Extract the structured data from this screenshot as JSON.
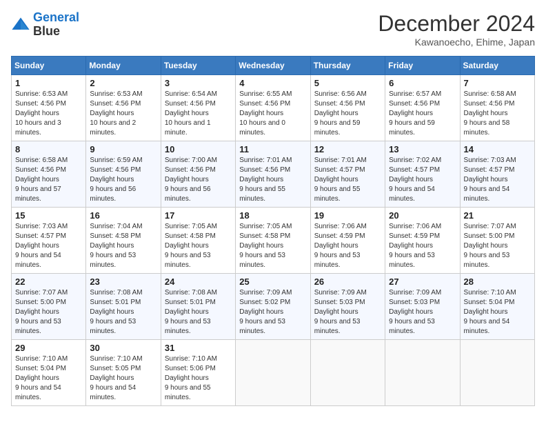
{
  "header": {
    "logo_line1": "General",
    "logo_line2": "Blue",
    "month_title": "December 2024",
    "location": "Kawanoecho, Ehime, Japan"
  },
  "weekdays": [
    "Sunday",
    "Monday",
    "Tuesday",
    "Wednesday",
    "Thursday",
    "Friday",
    "Saturday"
  ],
  "weeks": [
    [
      {
        "day": "1",
        "sunrise": "6:53 AM",
        "sunset": "4:56 PM",
        "daylight": "10 hours and 3 minutes."
      },
      {
        "day": "2",
        "sunrise": "6:53 AM",
        "sunset": "4:56 PM",
        "daylight": "10 hours and 2 minutes."
      },
      {
        "day": "3",
        "sunrise": "6:54 AM",
        "sunset": "4:56 PM",
        "daylight": "10 hours and 1 minute."
      },
      {
        "day": "4",
        "sunrise": "6:55 AM",
        "sunset": "4:56 PM",
        "daylight": "10 hours and 0 minutes."
      },
      {
        "day": "5",
        "sunrise": "6:56 AM",
        "sunset": "4:56 PM",
        "daylight": "9 hours and 59 minutes."
      },
      {
        "day": "6",
        "sunrise": "6:57 AM",
        "sunset": "4:56 PM",
        "daylight": "9 hours and 59 minutes."
      },
      {
        "day": "7",
        "sunrise": "6:58 AM",
        "sunset": "4:56 PM",
        "daylight": "9 hours and 58 minutes."
      }
    ],
    [
      {
        "day": "8",
        "sunrise": "6:58 AM",
        "sunset": "4:56 PM",
        "daylight": "9 hours and 57 minutes."
      },
      {
        "day": "9",
        "sunrise": "6:59 AM",
        "sunset": "4:56 PM",
        "daylight": "9 hours and 56 minutes."
      },
      {
        "day": "10",
        "sunrise": "7:00 AM",
        "sunset": "4:56 PM",
        "daylight": "9 hours and 56 minutes."
      },
      {
        "day": "11",
        "sunrise": "7:01 AM",
        "sunset": "4:56 PM",
        "daylight": "9 hours and 55 minutes."
      },
      {
        "day": "12",
        "sunrise": "7:01 AM",
        "sunset": "4:57 PM",
        "daylight": "9 hours and 55 minutes."
      },
      {
        "day": "13",
        "sunrise": "7:02 AM",
        "sunset": "4:57 PM",
        "daylight": "9 hours and 54 minutes."
      },
      {
        "day": "14",
        "sunrise": "7:03 AM",
        "sunset": "4:57 PM",
        "daylight": "9 hours and 54 minutes."
      }
    ],
    [
      {
        "day": "15",
        "sunrise": "7:03 AM",
        "sunset": "4:57 PM",
        "daylight": "9 hours and 54 minutes."
      },
      {
        "day": "16",
        "sunrise": "7:04 AM",
        "sunset": "4:58 PM",
        "daylight": "9 hours and 53 minutes."
      },
      {
        "day": "17",
        "sunrise": "7:05 AM",
        "sunset": "4:58 PM",
        "daylight": "9 hours and 53 minutes."
      },
      {
        "day": "18",
        "sunrise": "7:05 AM",
        "sunset": "4:58 PM",
        "daylight": "9 hours and 53 minutes."
      },
      {
        "day": "19",
        "sunrise": "7:06 AM",
        "sunset": "4:59 PM",
        "daylight": "9 hours and 53 minutes."
      },
      {
        "day": "20",
        "sunrise": "7:06 AM",
        "sunset": "4:59 PM",
        "daylight": "9 hours and 53 minutes."
      },
      {
        "day": "21",
        "sunrise": "7:07 AM",
        "sunset": "5:00 PM",
        "daylight": "9 hours and 53 minutes."
      }
    ],
    [
      {
        "day": "22",
        "sunrise": "7:07 AM",
        "sunset": "5:00 PM",
        "daylight": "9 hours and 53 minutes."
      },
      {
        "day": "23",
        "sunrise": "7:08 AM",
        "sunset": "5:01 PM",
        "daylight": "9 hours and 53 minutes."
      },
      {
        "day": "24",
        "sunrise": "7:08 AM",
        "sunset": "5:01 PM",
        "daylight": "9 hours and 53 minutes."
      },
      {
        "day": "25",
        "sunrise": "7:09 AM",
        "sunset": "5:02 PM",
        "daylight": "9 hours and 53 minutes."
      },
      {
        "day": "26",
        "sunrise": "7:09 AM",
        "sunset": "5:03 PM",
        "daylight": "9 hours and 53 minutes."
      },
      {
        "day": "27",
        "sunrise": "7:09 AM",
        "sunset": "5:03 PM",
        "daylight": "9 hours and 53 minutes."
      },
      {
        "day": "28",
        "sunrise": "7:10 AM",
        "sunset": "5:04 PM",
        "daylight": "9 hours and 54 minutes."
      }
    ],
    [
      {
        "day": "29",
        "sunrise": "7:10 AM",
        "sunset": "5:04 PM",
        "daylight": "9 hours and 54 minutes."
      },
      {
        "day": "30",
        "sunrise": "7:10 AM",
        "sunset": "5:05 PM",
        "daylight": "9 hours and 54 minutes."
      },
      {
        "day": "31",
        "sunrise": "7:10 AM",
        "sunset": "5:06 PM",
        "daylight": "9 hours and 55 minutes."
      },
      null,
      null,
      null,
      null
    ]
  ],
  "labels": {
    "sunrise": "Sunrise:",
    "sunset": "Sunset:",
    "daylight": "Daylight hours"
  }
}
